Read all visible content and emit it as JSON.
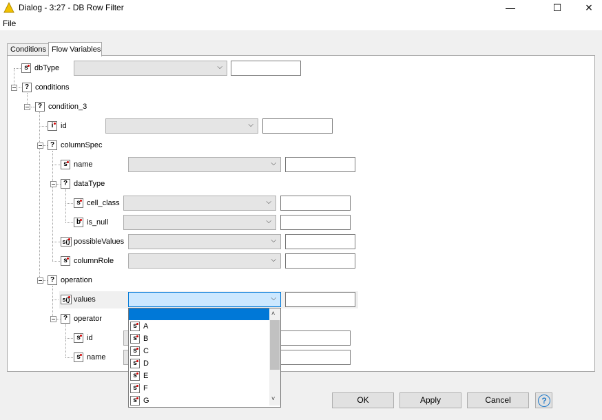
{
  "window": {
    "title": "Dialog - 3:27 - DB Row Filter",
    "minimize": "—",
    "maximize": "☐",
    "close": "✕"
  },
  "menu": {
    "file": "File"
  },
  "tabs": [
    {
      "label": "Conditions",
      "active": false
    },
    {
      "label": "Flow Variables",
      "active": true
    }
  ],
  "tree": {
    "dbType": {
      "icon": "s",
      "label": "dbType"
    },
    "conditions": {
      "icon": "?",
      "label": "conditions"
    },
    "condition_3": {
      "icon": "?",
      "label": "condition_3"
    },
    "id": {
      "icon": "i",
      "label": "id"
    },
    "columnSpec": {
      "icon": "?",
      "label": "columnSpec"
    },
    "name": {
      "icon": "s",
      "label": "name"
    },
    "dataType": {
      "icon": "?",
      "label": "dataType"
    },
    "cell_class": {
      "icon": "s",
      "label": "cell_class"
    },
    "is_null": {
      "icon": "b",
      "label": "is_null"
    },
    "possibleValues": {
      "icon": "s()",
      "label": "possibleValues"
    },
    "columnRole": {
      "icon": "s",
      "label": "columnRole"
    },
    "operation": {
      "icon": "?",
      "label": "operation"
    },
    "values": {
      "icon": "s()",
      "label": "values"
    },
    "operator": {
      "icon": "?",
      "label": "operator"
    },
    "operator_id": {
      "icon": "s",
      "label": "id"
    },
    "operator_name": {
      "icon": "s",
      "label": "name"
    }
  },
  "dropdown": {
    "items": [
      "A",
      "B",
      "C",
      "D",
      "E",
      "F",
      "G"
    ],
    "icon": "s"
  },
  "buttons": {
    "ok": "OK",
    "apply": "Apply",
    "cancel": "Cancel",
    "help": "?"
  },
  "colors": {
    "accent": "#0078d7",
    "variable_dot": "#d40000",
    "title_icon": "#f2c200"
  }
}
